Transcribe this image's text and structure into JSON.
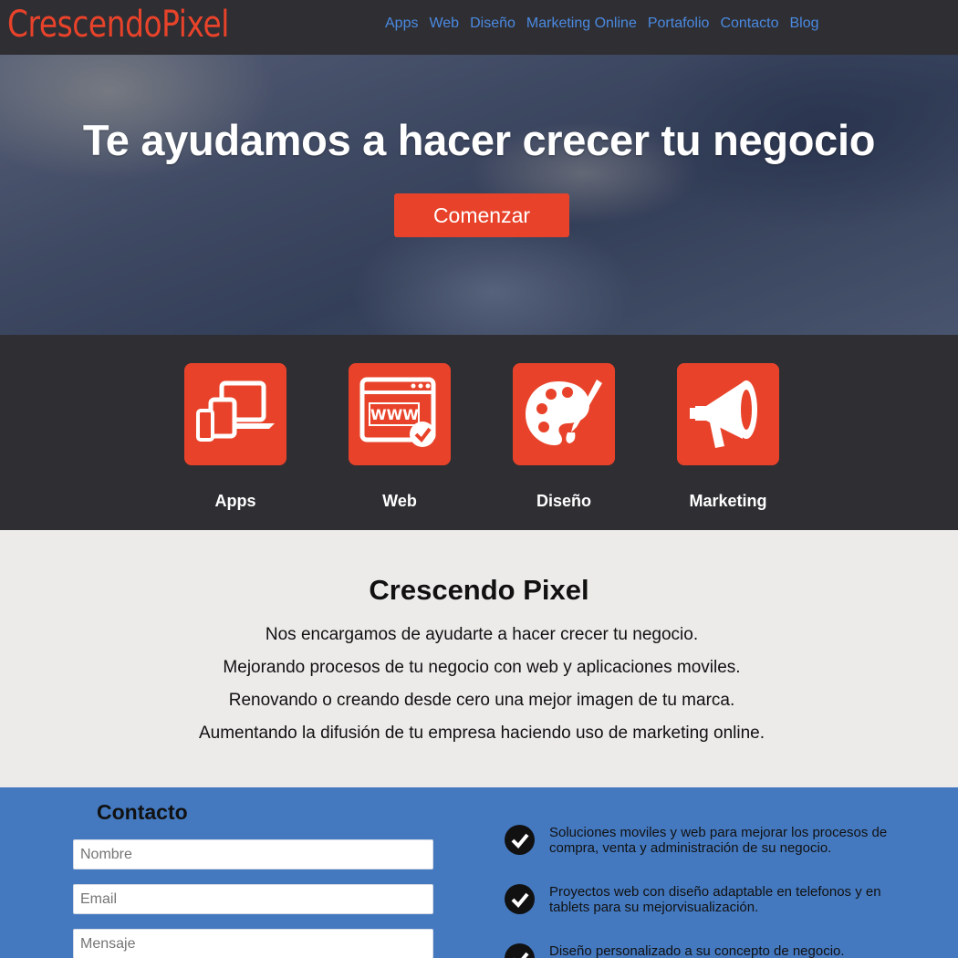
{
  "header": {
    "logo": "CrescendoPixel",
    "nav": [
      "Apps",
      "Web",
      "Diseño",
      "Marketing Online",
      "Portafolio",
      "Contacto",
      "Blog"
    ]
  },
  "hero": {
    "title": "Te ayudamos a hacer crecer tu negocio",
    "button": "Comenzar"
  },
  "services": [
    {
      "label": "Apps",
      "icon": "devices-icon"
    },
    {
      "label": "Web",
      "icon": "www-browser-icon"
    },
    {
      "label": "Diseño",
      "icon": "palette-icon"
    },
    {
      "label": "Marketing",
      "icon": "megaphone-icon"
    }
  ],
  "about": {
    "title": "Crescendo Pixel",
    "lines": [
      "Nos encargamos de ayudarte a hacer crecer tu negocio.",
      "Mejorando procesos de tu negocio con web y aplicaciones moviles.",
      "Renovando o creando desde cero una mejor imagen de tu marca.",
      "Aumentando la difusión de tu empresa haciendo uso de marketing online."
    ]
  },
  "contact": {
    "title": "Contacto",
    "fields": {
      "name_placeholder": "Nombre",
      "email_placeholder": "Email",
      "message_placeholder": "Mensaje"
    },
    "features": [
      "Soluciones moviles y web para mejorar los procesos de compra, venta y administración de su negocio.",
      "Proyectos web con diseño adaptable en telefonos y en tablets para su mejorvisualización.",
      "Diseño personalizado a su concepto de negocio."
    ]
  },
  "colors": {
    "accent": "#e8432a",
    "dark": "#2f2e33",
    "link": "#4a8ae0",
    "contact_bg": "#4479c0",
    "about_bg": "#edebea"
  }
}
